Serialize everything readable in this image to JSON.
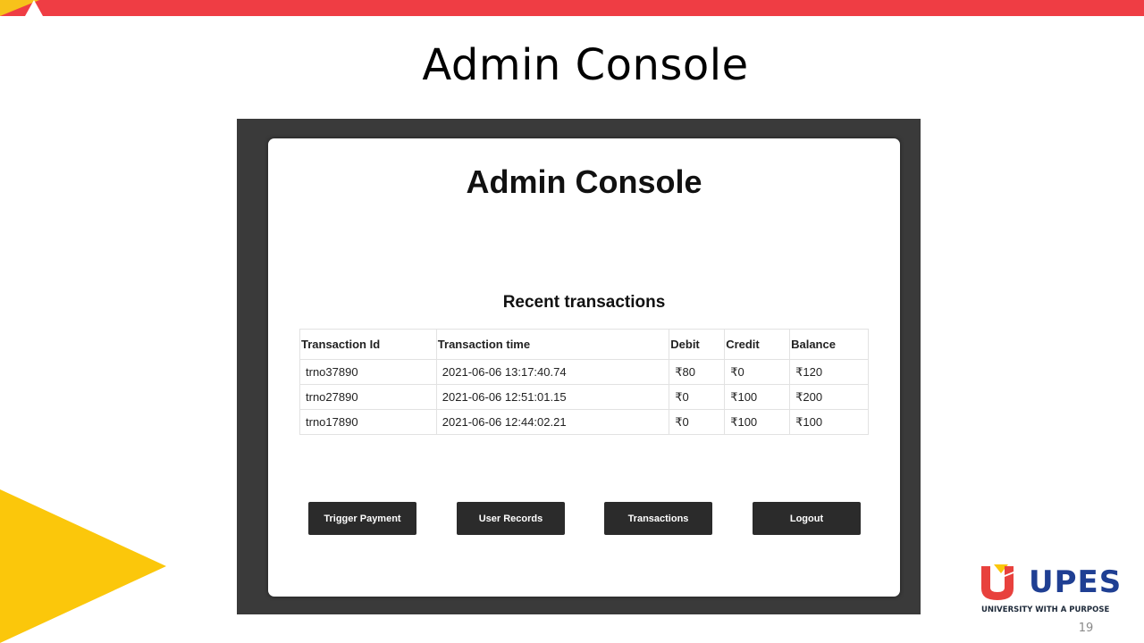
{
  "slide": {
    "title": "Admin Console",
    "page_number": "19"
  },
  "console": {
    "title": "Admin Console",
    "section_title": "Recent transactions",
    "columns": [
      "Transaction Id",
      "Transaction time",
      "Debit",
      "Credit",
      "Balance"
    ],
    "rows": [
      [
        "trno37890",
        "2021-06-06 13:17:40.74",
        "₹80",
        "₹0",
        "₹120"
      ],
      [
        "trno27890",
        "2021-06-06 12:51:01.15",
        "₹0",
        "₹100",
        "₹200"
      ],
      [
        "trno17890",
        "2021-06-06 12:44:02.21",
        "₹0",
        "₹100",
        "₹100"
      ]
    ],
    "buttons": {
      "trigger_payment": "Trigger Payment",
      "user_records": "User Records",
      "transactions": "Transactions",
      "logout": "Logout"
    }
  },
  "logo": {
    "name": "UPES",
    "tagline": "UNIVERSITY WITH A PURPOSE"
  },
  "colors": {
    "top_bar_red": "#ef3d44",
    "accent_yellow": "#fbc70b",
    "frame_dark": "#3a3a3a",
    "button_dark": "#2b2b2b",
    "logo_blue": "#1f3f93",
    "logo_red": "#e8413d"
  }
}
